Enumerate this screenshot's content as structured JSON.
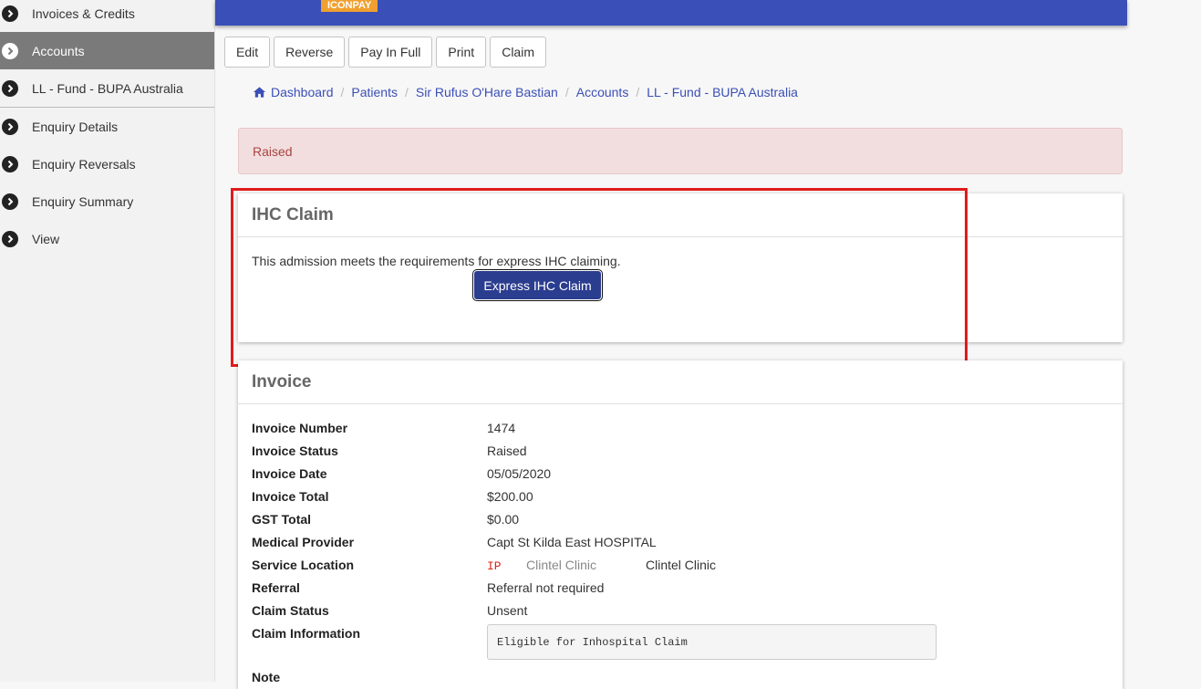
{
  "sidebar": {
    "items": [
      {
        "label": "Invoices & Credits"
      },
      {
        "label": "Accounts"
      },
      {
        "label": "LL - Fund - BUPA Australia"
      },
      {
        "label": "Enquiry Details"
      },
      {
        "label": "Enquiry Reversals"
      },
      {
        "label": "Enquiry Summary"
      },
      {
        "label": "View"
      }
    ],
    "active_index": 1
  },
  "header": {
    "brand": "ICONPAY",
    "brand_color": "#f0a030",
    "bar_color": "#3a4fb7"
  },
  "toolbar": {
    "edit": "Edit",
    "reverse": "Reverse",
    "pay_in_full": "Pay In Full",
    "print": "Print",
    "claim": "Claim"
  },
  "breadcrumb": [
    "Dashboard",
    "Patients",
    "Sir Rufus O'Hare Bastian",
    "Accounts",
    "LL - Fund - BUPA Australia"
  ],
  "alert": {
    "text": "Raised"
  },
  "ihc_panel": {
    "title": "IHC Claim",
    "message": "This admission meets the requirements for express IHC claiming.",
    "button": "Express IHC Claim"
  },
  "invoice": {
    "title": "Invoice",
    "rows": [
      {
        "label": "Invoice Number",
        "value": "1474"
      },
      {
        "label": "Invoice Status",
        "value": "Raised"
      },
      {
        "label": "Invoice Date",
        "value": "05/05/2020"
      },
      {
        "label": "Invoice Total",
        "value": "$200.00"
      },
      {
        "label": "GST Total",
        "value": "$0.00"
      },
      {
        "label": "Medical Provider",
        "value": "Capt St Kilda East HOSPITAL"
      },
      {
        "label": "Service Location",
        "code": "IP",
        "value": "Clintel Clinic",
        "value2": "Clintel Clinic"
      },
      {
        "label": "Referral",
        "value": "Referral not required"
      },
      {
        "label": "Claim Status",
        "value": "Unsent"
      },
      {
        "label": "Claim Information",
        "value": "Eligible for Inhospital Claim"
      },
      {
        "label": "Note",
        "value": ""
      }
    ]
  }
}
